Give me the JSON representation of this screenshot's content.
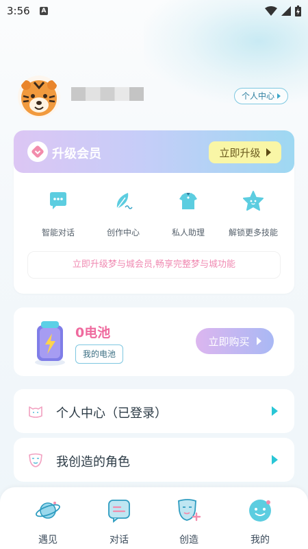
{
  "status": {
    "time": "3:56",
    "a_badge": "A"
  },
  "profile": {
    "personal_center_label": "个人中心"
  },
  "vip": {
    "title": "升级会员",
    "upgrade_label": "立即升级",
    "features": [
      {
        "label": "智能对话",
        "icon": "chat-bubble-icon"
      },
      {
        "label": "创作中心",
        "icon": "leaf-pen-icon"
      },
      {
        "label": "私人助理",
        "icon": "shirt-icon"
      },
      {
        "label": "解锁更多技能",
        "icon": "star-icon"
      }
    ],
    "note": "立即升级梦与城会员,畅享完整梦与城功能"
  },
  "battery": {
    "count_label": "0电池",
    "my_battery_label": "我的电池",
    "buy_label": "立即购买"
  },
  "rows": [
    {
      "label": "个人中心（已登录）",
      "icon": "cat-face-icon"
    },
    {
      "label": "我创造的角色",
      "icon": "mask-icon"
    }
  ],
  "nav": [
    {
      "label": "遇见",
      "icon": "planet-icon"
    },
    {
      "label": "对话",
      "icon": "chat-icon"
    },
    {
      "label": "创造",
      "icon": "create-icon"
    },
    {
      "label": "我的",
      "icon": "face-icon"
    }
  ],
  "colors": {
    "accent_pink": "#ef6a9e",
    "accent_cyan": "#29c6d6",
    "vip_button": "#f9f6a6"
  }
}
